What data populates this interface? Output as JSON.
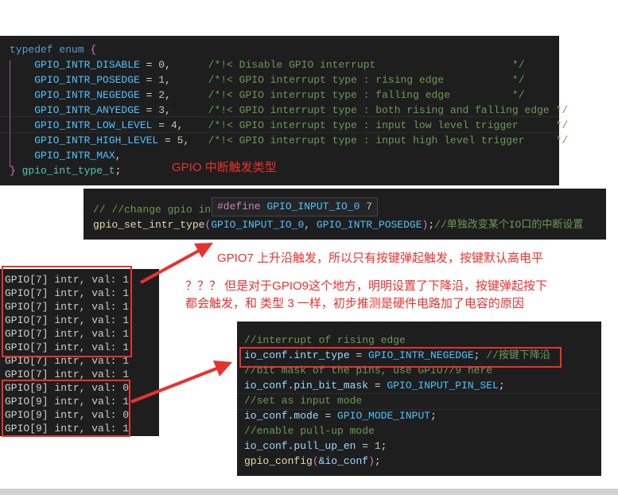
{
  "enum_panel": {
    "lines": [
      [
        [
          "typedef enum ",
          "kw"
        ],
        [
          "{",
          "br"
        ]
      ],
      [
        [
          "    GPIO_INTR_DISABLE",
          "en"
        ],
        [
          " = ",
          "pl"
        ],
        [
          "0",
          "num"
        ],
        [
          ",      ",
          "pl"
        ],
        [
          "/*!< Disable GPIO interrupt                      */",
          "cm"
        ]
      ],
      [
        [
          "    GPIO_INTR_POSEDGE",
          "en"
        ],
        [
          " = ",
          "pl"
        ],
        [
          "1",
          "num"
        ],
        [
          ",      ",
          "pl"
        ],
        [
          "/*!< GPIO interrupt type : rising edge           */",
          "cm"
        ]
      ],
      [
        [
          "    GPIO_INTR_NEGEDGE",
          "en"
        ],
        [
          " = ",
          "pl"
        ],
        [
          "2",
          "num"
        ],
        [
          ",      ",
          "pl"
        ],
        [
          "/*!< GPIO interrupt type : falling edge          */",
          "cm"
        ]
      ],
      [
        [
          "    GPIO_INTR_ANYEDGE",
          "en"
        ],
        [
          " = ",
          "pl"
        ],
        [
          "3",
          "num"
        ],
        [
          ",      ",
          "pl"
        ],
        [
          "/*!< GPIO interrupt type : both rising and falling edge */",
          "cm"
        ]
      ],
      [
        [
          "    GPIO_INTR_LOW_LEVEL",
          "en"
        ],
        [
          " = ",
          "pl"
        ],
        [
          "4",
          "num"
        ],
        [
          ",    ",
          "pl"
        ],
        [
          "/*!< GPIO interrupt type : input low level trigger      */",
          "cm"
        ]
      ],
      [
        [
          "    GPIO_INTR_HIGH_LEVEL",
          "en"
        ],
        [
          " = ",
          "pl"
        ],
        [
          "5",
          "num"
        ],
        [
          ",   ",
          "pl"
        ],
        [
          "/*!< GPIO interrupt type : input high level trigger     */",
          "cm"
        ]
      ],
      [
        [
          "    GPIO_INTR_MAX",
          "en"
        ],
        [
          ",",
          "pl"
        ]
      ],
      [
        [
          "}",
          "br"
        ],
        [
          " gpio_int_type_t",
          "ty"
        ],
        [
          ";",
          "pl"
        ]
      ]
    ],
    "annotation": "GPIO 中断触发类型"
  },
  "set_panel": {
    "lines": [
      [
        [
          "// //change gpio in",
          "cm"
        ]
      ],
      [
        [
          "gpio_set_intr_type",
          "fn"
        ],
        [
          "(",
          "br"
        ],
        [
          "GPIO_INPUT_IO_0",
          "en"
        ],
        [
          ", ",
          "pl"
        ],
        [
          "GPIO_INTR_POSEDGE",
          "en"
        ],
        [
          ")",
          "br"
        ],
        [
          ";",
          "pl"
        ],
        [
          "//单独改变某个IO口的中断设置",
          "cm"
        ]
      ]
    ],
    "hover_tooltip": [
      [
        "#define ",
        "mac"
      ],
      [
        "GPIO_INPUT_IO_0",
        "en"
      ],
      [
        " 7",
        "num"
      ]
    ]
  },
  "notes": {
    "gpio7": "GPIO7 上升沿触发，所以只有按键弹起触发，按键默认高电平",
    "gpio9_line1": "？？？ 但是对于GPIO9这个地方，明明设置了下降沿，按键弹起按下",
    "gpio9_line2": "都会触发，和 类型 3 一样，初步推测是硬件电路加了电容的原因"
  },
  "terminal": {
    "lines": [
      "GPIO[7] intr, val: 1",
      "GPIO[7] intr, val: 1",
      "GPIO[7] intr, val: 1",
      "GPIO[7] intr, val: 1",
      "GPIO[7] intr, val: 1",
      "GPIO[7] intr, val: 1",
      "GPIO[7] intr, val: 1",
      "GPIO[7] intr, val: 1",
      "GPIO[9] intr, val: 0",
      "GPIO[9] intr, val: 1",
      "GPIO[9] intr, val: 0",
      "GPIO[9] intr, val: 1"
    ]
  },
  "config_panel": {
    "lines": [
      [
        [
          "//interrupt of rising edge",
          "cm"
        ]
      ],
      [
        [
          "io_conf",
          "var"
        ],
        [
          ".",
          "pl"
        ],
        [
          "intr_type",
          "var"
        ],
        [
          " = ",
          "pl"
        ],
        [
          "GPIO_INTR_NEGEDGE",
          "en"
        ],
        [
          "; ",
          "pl"
        ],
        [
          "//按键下降沿",
          "cm"
        ]
      ],
      [
        [
          "//bit mask of the pins, use GPIO7/9 here",
          "cm"
        ]
      ],
      [
        [
          "io_conf",
          "var"
        ],
        [
          ".",
          "pl"
        ],
        [
          "pin_bit_mask",
          "var"
        ],
        [
          " = ",
          "pl"
        ],
        [
          "GPIO_INPUT_PIN_SEL",
          "en"
        ],
        [
          ";",
          "pl"
        ]
      ],
      [
        [
          "//set as input ",
          "cm"
        ],
        [
          "mode",
          "cm"
        ]
      ],
      [
        [
          "io_conf",
          "var"
        ],
        [
          ".",
          "pl"
        ],
        [
          "mode",
          "var"
        ],
        [
          " = ",
          "pl"
        ],
        [
          "GPIO_MODE_INPUT",
          "en"
        ],
        [
          ";",
          "pl"
        ]
      ],
      [
        [
          "//enable pull-up ",
          "cm"
        ],
        [
          "mode",
          "cm"
        ]
      ],
      [
        [
          "io_conf",
          "var"
        ],
        [
          ".",
          "pl"
        ],
        [
          "pull_up_en",
          "var"
        ],
        [
          " = ",
          "pl"
        ],
        [
          "1",
          "num"
        ],
        [
          ";",
          "pl"
        ]
      ],
      [
        [
          "gpio_config",
          "fn"
        ],
        [
          "(",
          "br"
        ],
        [
          "&io_conf",
          "var"
        ],
        [
          ")",
          "br"
        ],
        [
          ";",
          "pl"
        ]
      ]
    ]
  }
}
